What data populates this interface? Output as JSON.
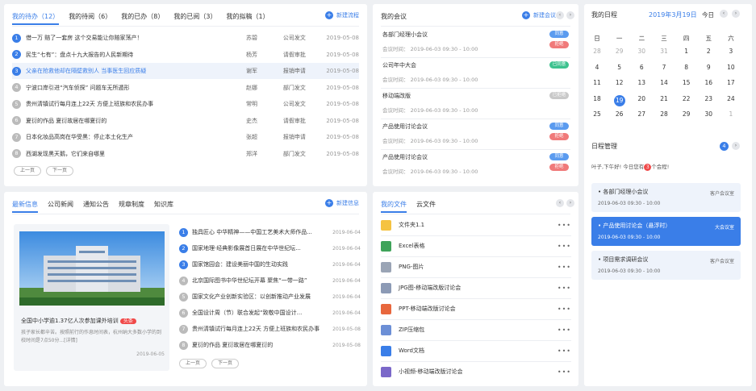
{
  "todo": {
    "tabs": [
      "我的待办（12）",
      "我的待阅（6）",
      "我的已办（8）",
      "我的已阅（3）",
      "我的拟稿（1）"
    ],
    "new_label": "新建流程",
    "rows": [
      {
        "n": "1",
        "t": "借一万 赔了一套房 这个交易能让你赔家荡产！",
        "p": "苏碧",
        "k": "公司发文",
        "d": "2019-05-08"
      },
      {
        "n": "2",
        "t": "民生“七有”：盘点十九大报告的人民新期待",
        "p": "杨芳",
        "k": "请假审批",
        "d": "2019-05-08"
      },
      {
        "n": "3",
        "t": "父亲在抢救他却在隔壁救别人 当事医生回应质疑",
        "p": "谢军",
        "k": "报销申请",
        "d": "2019-05-08"
      },
      {
        "n": "4",
        "t": "宁波口岸引进“汽车侦探” 问题车无所遁形",
        "p": "赵娜",
        "k": "部门发文",
        "d": "2019-05-08"
      },
      {
        "n": "5",
        "t": "贵州清镇试行每月连上22天 方便上班族和农民办事",
        "p": "常明",
        "k": "公司发文",
        "d": "2019-05-08"
      },
      {
        "n": "6",
        "t": "夏衍的作品 夏衍故居在哪夏衍的",
        "p": "史杰",
        "k": "请假审批",
        "d": "2019-05-08"
      },
      {
        "n": "7",
        "t": "日本化妆品高岗在华受黑：停止本土化生产",
        "p": "张超",
        "k": "报销申请",
        "d": "2019-05-08"
      },
      {
        "n": "8",
        "t": "西湖发现黑天鹅，它们来自哪里",
        "p": "郑洋",
        "k": "部门发文",
        "d": "2019-05-08"
      }
    ],
    "prev": "上一页",
    "next": "下一页"
  },
  "meeting": {
    "title": "我的会议",
    "new_label": "新建会议",
    "items": [
      {
        "t": "各部门经理小会议",
        "time": "会议时间： 2019-06-03  09:30 - 10:00",
        "b1": "同意",
        "b1c": "#5b9bef",
        "b2": "拒绝",
        "b2c": "#f07a7a"
      },
      {
        "t": "公司年中大会",
        "time": "会议时间： 2019-06-03  09:30 - 10:00",
        "b1": "已同意",
        "b1c": "#3ec28f",
        "b2": "",
        "b2c": ""
      },
      {
        "t": "移动端改版",
        "time": "会议时间： 2019-06-03  09:30 - 10:00",
        "b1": "已拒绝",
        "b1c": "#c9c9c9",
        "b2": "",
        "b2c": ""
      },
      {
        "t": "产品使用讨论会议",
        "time": "会议时间： 2019-06-03  09:30 - 10:00",
        "b1": "同意",
        "b1c": "#5b9bef",
        "b2": "拒绝",
        "b2c": "#f07a7a"
      },
      {
        "t": "产品使用讨论会议",
        "time": "会议时间： 2019-06-03  09:30 - 10:00",
        "b1": "同意",
        "b1c": "#5b9bef",
        "b2": "拒绝",
        "b2c": "#f07a7a"
      }
    ]
  },
  "calendar": {
    "title": "我的日程",
    "month": "2019年3月19日",
    "today": "今日",
    "weekdays": [
      "日",
      "一",
      "二",
      "三",
      "四",
      "五",
      "六"
    ],
    "weeks": [
      [
        "28",
        "29",
        "30",
        "31",
        "1",
        "2",
        "3"
      ],
      [
        "4",
        "5",
        "6",
        "7",
        "8",
        "9",
        "10"
      ],
      [
        "11",
        "12",
        "13",
        "14",
        "15",
        "16",
        "17"
      ],
      [
        "18",
        "19",
        "20",
        "21",
        "22",
        "23",
        "24"
      ],
      [
        "25",
        "26",
        "27",
        "28",
        "29",
        "30",
        "1"
      ]
    ],
    "mgmt_title": "日程管理",
    "count": "4",
    "greet_a": "叶子,下午好! 今日您有",
    "greet_n": "3",
    "greet_b": "个会程!",
    "items": [
      {
        "n": "各部门经理小会议",
        "time": "2019-06-03   09:30 - 10:00",
        "room": "客户会议室"
      },
      {
        "n": "产品使用讨论会（悬浮时）",
        "time": "2019-06-03   09:30 - 10:00",
        "room": "大会议室"
      },
      {
        "n": "项目需求调研会议",
        "time": "2019-06-03   09:30 - 10:00",
        "room": "客户会议室"
      }
    ]
  },
  "news": {
    "tabs": [
      "最新信息",
      "公司新闻",
      "通知公告",
      "规章制度",
      "知识库"
    ],
    "new_label": "新建信息",
    "feature_title": "全国中小学逾1.37亿人次参加课外培训",
    "feature_tag": "头条",
    "feature_desc": "孩子家长都辛苦。按照前行的作息时间表，杭州纳大多数小学的到校时间是7点50分...[详情]",
    "feature_date": "2019-06-05",
    "rows": [
      {
        "n": "1",
        "t": "独具匠心 中华精神——中国工艺美术大师作品...",
        "d": "2019-06-04"
      },
      {
        "n": "2",
        "t": "国家地理·经典影像展首日展在中华世纪坛...",
        "d": "2019-06-04"
      },
      {
        "n": "3",
        "t": "国家馆园会：建设美丽中国的生动实践",
        "d": "2019-06-04"
      },
      {
        "n": "4",
        "t": "北京国际图书中华世纪坛开幕 聚焦“一带一路”",
        "d": "2019-06-04"
      },
      {
        "n": "5",
        "t": "国家文化产业创新实验区：以创新推动产业发展",
        "d": "2019-06-04"
      },
      {
        "n": "6",
        "t": "全国设计周（节）联合发起“致敬中国设计...",
        "d": "2019-06-04"
      },
      {
        "n": "7",
        "t": "贵州清镇试行每月连上22天 方便上班族和农民办事",
        "d": "2019-05-08"
      },
      {
        "n": "8",
        "t": "夏衍的作品 夏衍故居在哪夏衍的",
        "d": "2019-05-08"
      }
    ],
    "prev": "上一页",
    "next": "下一页"
  },
  "files": {
    "tabs": [
      "我的文件",
      "云文件"
    ],
    "items": [
      {
        "n": "文件夹1.1",
        "c": "#f5c342"
      },
      {
        "n": "Excel表格",
        "c": "#3fa35a"
      },
      {
        "n": "PNG-图片",
        "c": "#9aa4b5"
      },
      {
        "n": "JPG图-移动端改版讨论会",
        "c": "#8c9ab5"
      },
      {
        "n": "PPT-移动端改版讨论会",
        "c": "#e8673d"
      },
      {
        "n": "ZIP压缩包",
        "c": "#6c8fd6"
      },
      {
        "n": "Word文档",
        "c": "#3a7ee8"
      },
      {
        "n": "小视频-移动端改版讨论会",
        "c": "#7b68c9"
      }
    ],
    "more": "•••"
  }
}
